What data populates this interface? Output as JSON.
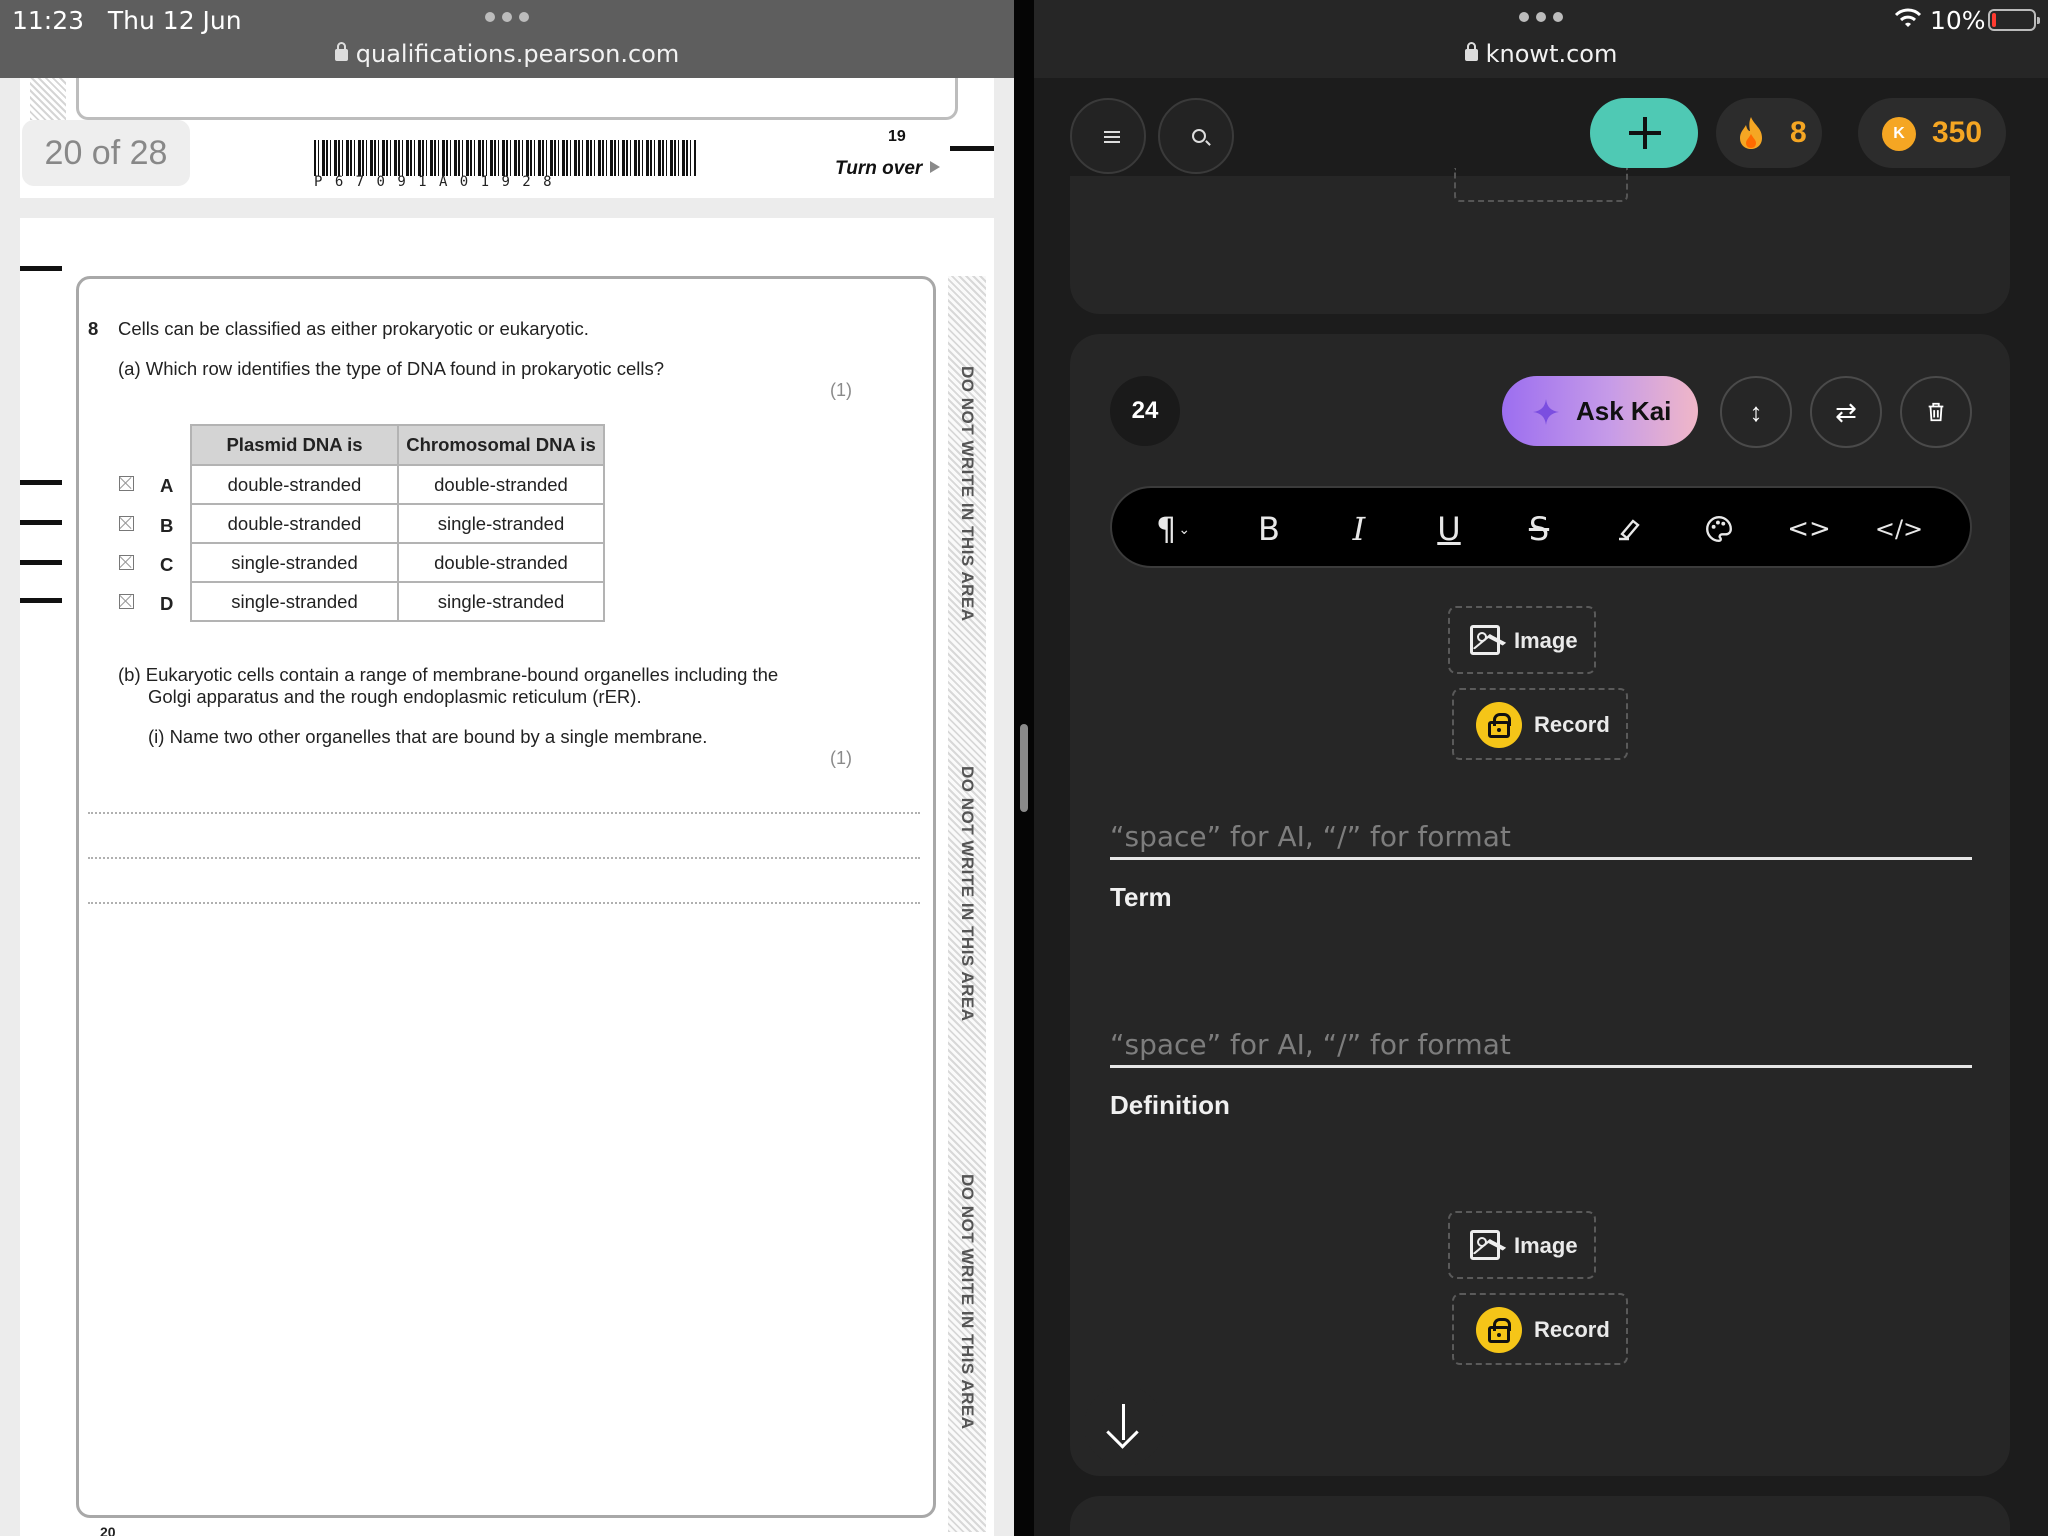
{
  "status_bar": {
    "time": "11:23",
    "date": "Thu 12 Jun",
    "battery": "10%",
    "wifi_icon": "wifi-icon",
    "battery_color": "#ff3b30"
  },
  "left_browser": {
    "url": "qualifications.pearson.com"
  },
  "right_browser": {
    "url": "knowt.com"
  },
  "exam": {
    "page_indicator": "20 of 28",
    "barcode_text": "P67091A01928",
    "page_number": "19",
    "turn_over": "Turn over",
    "margin_note": "DO NOT WRITE IN THIS AREA",
    "question_number": "8",
    "question_stem": "Cells can be classified as either prokaryotic or eukaryotic.",
    "part_a": "(a)  Which row identifies the type of DNA found in prokaryotic cells?",
    "part_a_marks": "(1)",
    "table": {
      "headers": [
        "Plasmid DNA is",
        "Chromosomal DNA is"
      ],
      "rows": [
        {
          "letter": "A",
          "plasmid": "double-stranded",
          "chromosomal": "double-stranded"
        },
        {
          "letter": "B",
          "plasmid": "double-stranded",
          "chromosomal": "single-stranded"
        },
        {
          "letter": "C",
          "plasmid": "single-stranded",
          "chromosomal": "double-stranded"
        },
        {
          "letter": "D",
          "plasmid": "single-stranded",
          "chromosomal": "single-stranded"
        }
      ]
    },
    "part_b_line1": "(b)  Eukaryotic cells contain a range of membrane-bound organelles including the",
    "part_b_line2": "Golgi apparatus and the rough endoplasmic reticulum (rER).",
    "part_b_i": "(i)   Name two other organelles that are bound by a single membrane.",
    "part_b_i_marks": "(1)",
    "footer_page": "20"
  },
  "knowt": {
    "streak": "8",
    "coins": "350",
    "coin_symbol": "K",
    "accent_color": "#4fc9b4",
    "card_number": "24",
    "ask_kai_label": "Ask Kai",
    "toolbar_icons": [
      "paragraph-icon",
      "bold-icon",
      "italic-icon",
      "underline-icon",
      "strikethrough-icon",
      "highlighter-icon",
      "palette-icon",
      "inline-code-icon",
      "code-block-icon"
    ],
    "term": {
      "image_label": "Image",
      "record_label": "Record",
      "placeholder": "“space” for AI, “/” for format",
      "label": "Term"
    },
    "definition": {
      "placeholder": "“space” for AI, “/” for format",
      "label": "Definition",
      "image_label": "Image",
      "record_label": "Record"
    }
  }
}
